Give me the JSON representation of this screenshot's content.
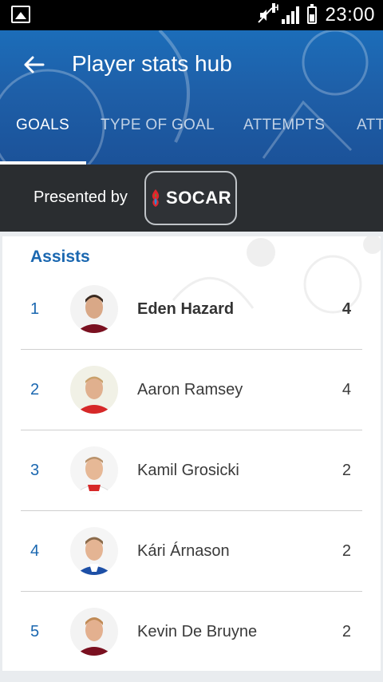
{
  "status_bar": {
    "time": "23:00",
    "network": "H"
  },
  "header": {
    "title": "Player stats hub"
  },
  "tabs": [
    {
      "label": "GOALS",
      "active": true
    },
    {
      "label": "TYPE OF GOAL",
      "active": false
    },
    {
      "label": "ATTEMPTS",
      "active": false
    },
    {
      "label": "ATT",
      "active": false
    }
  ],
  "sponsor": {
    "presented_label": "Presented by",
    "brand": "SOCAR"
  },
  "section": {
    "title": "Assists"
  },
  "players": [
    {
      "rank": "1",
      "name": "Eden Hazard",
      "value": "4",
      "highlight": true,
      "shirt": "#7a1020"
    },
    {
      "rank": "2",
      "name": "Aaron Ramsey",
      "value": "4",
      "highlight": false,
      "shirt": "#d62828"
    },
    {
      "rank": "3",
      "name": "Kamil Grosicki",
      "value": "2",
      "highlight": false,
      "shirt": "#ffffff"
    },
    {
      "rank": "4",
      "name": "Kári Árnason",
      "value": "2",
      "highlight": false,
      "shirt": "#1d4fa6"
    },
    {
      "rank": "5",
      "name": "Kevin De Bruyne",
      "value": "2",
      "highlight": false,
      "shirt": "#7a1020"
    }
  ],
  "colors": {
    "accent": "#1a67b0",
    "appbar": "#1e5fa8",
    "sponsor_bg": "#2a2d30"
  }
}
